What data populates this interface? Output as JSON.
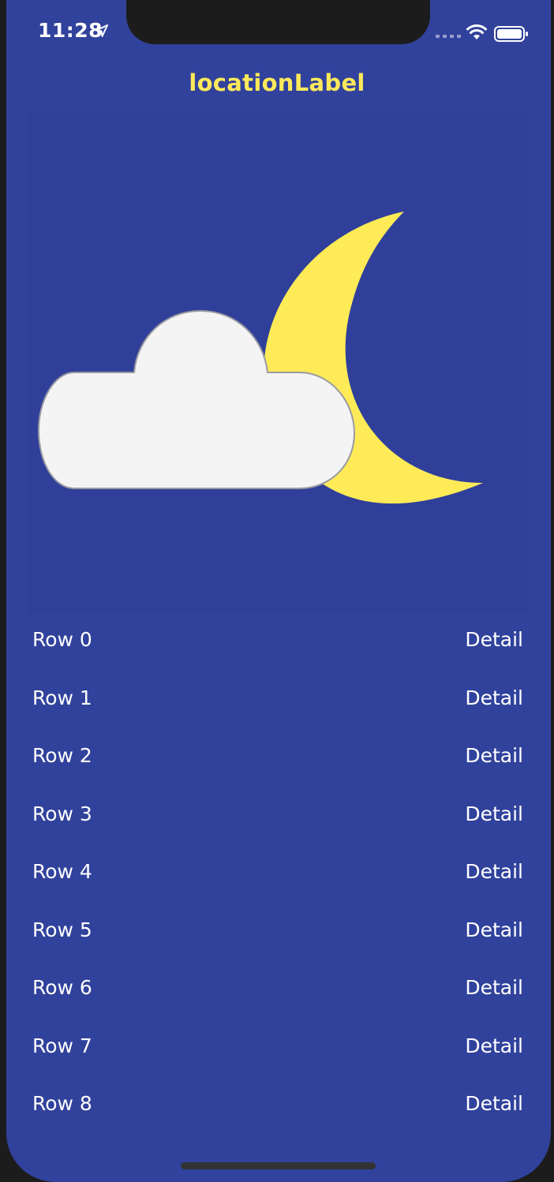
{
  "status_bar": {
    "time": "11:28",
    "icons": [
      "location-arrow-icon",
      "signal-icon",
      "wifi-icon",
      "battery-icon"
    ]
  },
  "header": {
    "title": "locationLabel"
  },
  "weather": {
    "icon": "partly-cloudy-night-icon",
    "colors": {
      "moon": "#ffeb57",
      "cloud": "#f4f4f4",
      "background": "#30409a"
    }
  },
  "table": {
    "rows": [
      {
        "label": "Row 0",
        "detail": "Detail"
      },
      {
        "label": "Row 1",
        "detail": "Detail"
      },
      {
        "label": "Row 2",
        "detail": "Detail"
      },
      {
        "label": "Row 3",
        "detail": "Detail"
      },
      {
        "label": "Row 4",
        "detail": "Detail"
      },
      {
        "label": "Row 5",
        "detail": "Detail"
      },
      {
        "label": "Row 6",
        "detail": "Detail"
      },
      {
        "label": "Row 7",
        "detail": "Detail"
      },
      {
        "label": "Row 8",
        "detail": "Detail"
      }
    ]
  },
  "theme": {
    "background": "#31429c",
    "accent": "#ffe95a",
    "text": "#ffffff"
  }
}
